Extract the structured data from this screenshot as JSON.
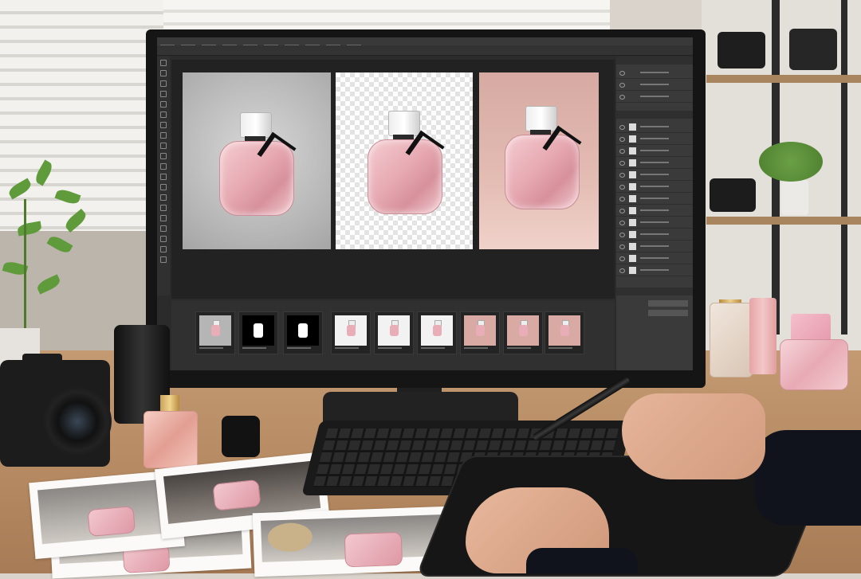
{
  "scene": {
    "type": "photo",
    "subject": "photo-editing-workstation",
    "palette": {
      "wall": "#d9d3cb",
      "desk_wood": "#b48860",
      "monitor_bezel": "#151515",
      "app_ui_dark": "#2b2b2b",
      "perfume_pink": "#e7a9b2",
      "bow_black": "#111111",
      "checkerboard": "#e3e3e3",
      "pink_backdrop": "#e3bcb3"
    }
  },
  "monitor": {
    "app": "photo-editor",
    "panes": [
      {
        "name": "original",
        "background": "grey-studio"
      },
      {
        "name": "cutout",
        "background": "transparent-checkerboard"
      },
      {
        "name": "composite",
        "background": "pink-sunlit"
      }
    ],
    "filmstrip": {
      "thumbnails": [
        {
          "kind": "grey"
        },
        {
          "kind": "mask"
        },
        {
          "kind": "mask"
        },
        {
          "kind": "cutout"
        },
        {
          "kind": "cutout"
        },
        {
          "kind": "cutout"
        },
        {
          "kind": "pink"
        },
        {
          "kind": "pink"
        },
        {
          "kind": "pink"
        }
      ]
    },
    "icons": {
      "toolbar": "tool-icon",
      "visibility": "eye-icon"
    }
  }
}
